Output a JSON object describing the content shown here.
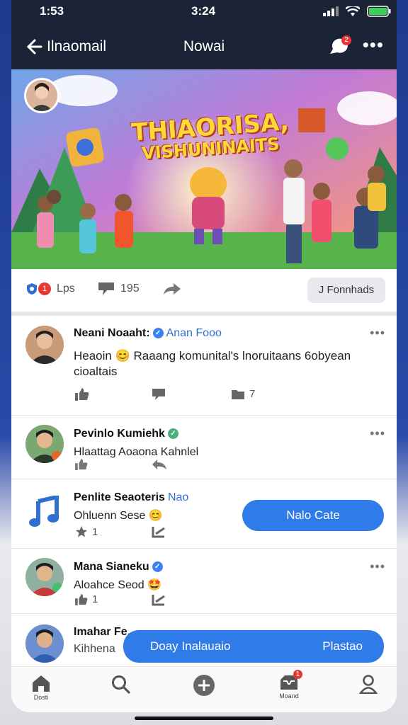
{
  "status_bar": {
    "time_left": "1:53",
    "time_center": "3:24"
  },
  "app_bar": {
    "left_title": "Ilnaomail",
    "center_title": "Nowai",
    "message_badge": "2"
  },
  "banner": {
    "title_line1": "THIAORISA,",
    "title_line2": "VISHUNINAITS"
  },
  "actions": {
    "like_count": "Lps",
    "like_badge": "1",
    "comment_count": "195",
    "chip_label": "J Fonnhads"
  },
  "feed": [
    {
      "name": "Neani Noaaht:",
      "verified": "✓",
      "link": "Anan Fooo",
      "text_emoji": "😊",
      "text_start": "Heaoin",
      "text": "Raaang komunital's lnoruitaans 6obyean cioaltais",
      "comments_count": "7"
    },
    {
      "name": "Pevinlo Kumiehk",
      "verified": "✓",
      "text": "Hlaattag Aoaona Kahnlel"
    },
    {
      "name": "Penlite Seaoteris",
      "link": "Nao",
      "text": "Ohluenn Sese",
      "text_emoji": "😊",
      "star_count": "1",
      "button": "Nalo Cate"
    },
    {
      "name": "Mana Sianeku",
      "verified": "✓",
      "text": "Aloahce Seod",
      "text_emoji": "🤩",
      "star_count": "1"
    },
    {
      "name": "Imahar Fe...",
      "text": "Kihhena",
      "banner_left": "Doay Inalauaio",
      "banner_right": "Plastao"
    }
  ],
  "bottom_nav": {
    "home_label": "Dosti",
    "notif_label": "Moand",
    "notif_badge": "1"
  },
  "colors": {
    "accent": "#2f7bea",
    "topbar": "#1b2436",
    "badge": "#e53935"
  }
}
